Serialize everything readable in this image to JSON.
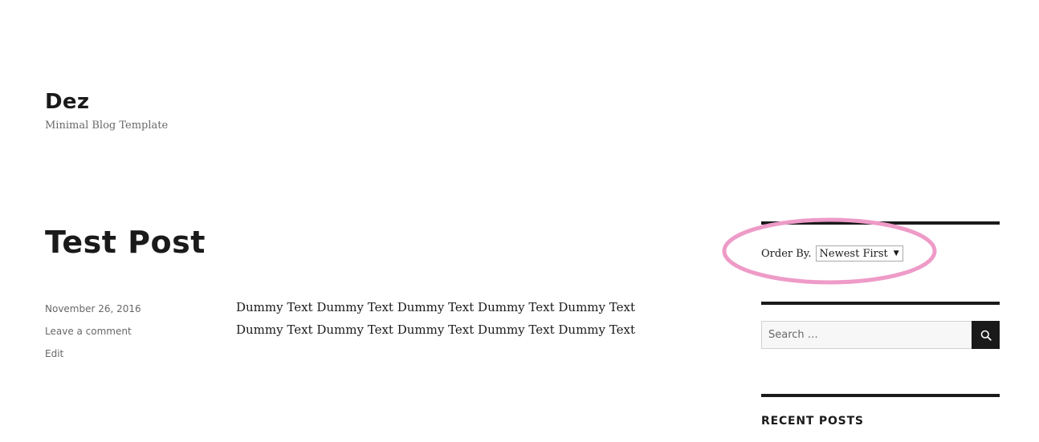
{
  "site": {
    "title": "Dez",
    "description": "Minimal Blog Template"
  },
  "post": {
    "title": "Test Post",
    "meta": {
      "date": "November 26, 2016",
      "comments_link": "Leave a comment",
      "edit_link": "Edit"
    },
    "content_lines": [
      "Dummy Text Dummy Text Dummy Text Dummy Text Dummy Text",
      "Dummy Text Dummy Text Dummy Text Dummy Text Dummy Text"
    ]
  },
  "sidebar": {
    "order_widget": {
      "label": "Order By.",
      "selected": "Newest First"
    },
    "search": {
      "placeholder": "Search …",
      "icon": "search-icon"
    },
    "recent_posts": {
      "title": "RECENT POSTS"
    }
  },
  "colors": {
    "text": "#1a1a1a",
    "muted": "#686868",
    "annotation": "#ee9bc8"
  }
}
